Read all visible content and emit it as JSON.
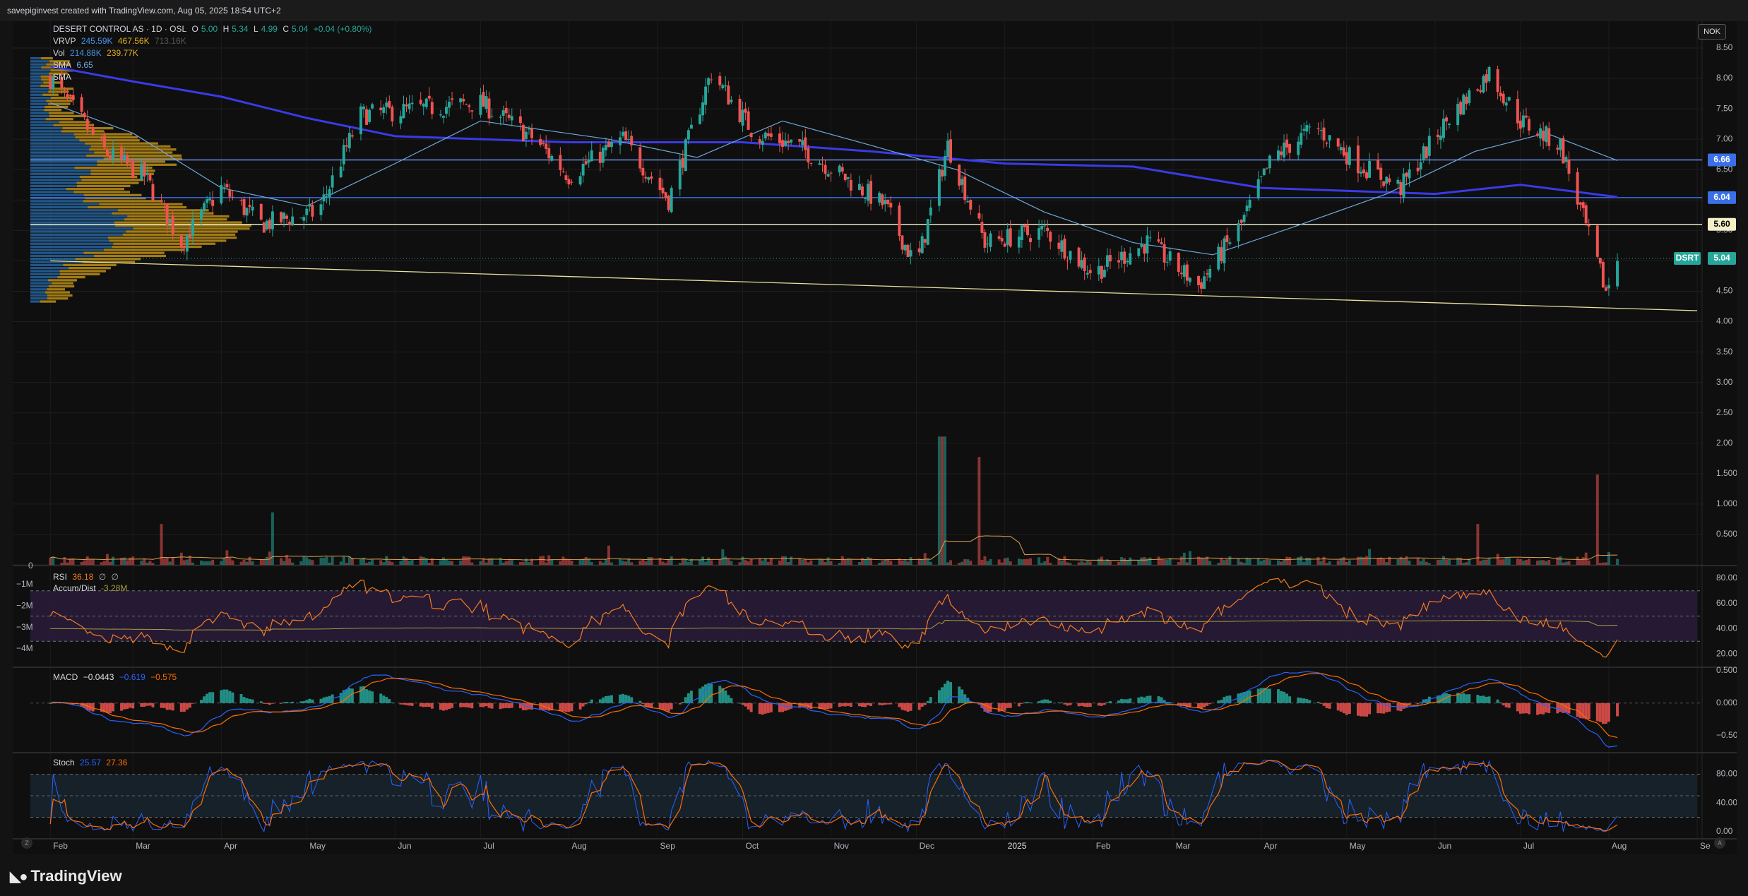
{
  "header": {
    "caption": "savepiginvest created with TradingView.com, Aug 05, 2025 18:54 UTC+2"
  },
  "currency_button": "NOK",
  "legend": {
    "title": "DESERT CONTROL AS · 1D · OSL",
    "ohlc": {
      "o_label": "O",
      "o": "5.00",
      "h_label": "H",
      "h": "5.34",
      "l_label": "L",
      "l": "4.99",
      "c_label": "C",
      "c": "5.04",
      "change": "+0.04 (+0.80%)"
    },
    "vrvp": {
      "label": "VRVP",
      "v1": "245.59K",
      "v2": "467.56K",
      "v3": "713.16K"
    },
    "vol": {
      "label": "Vol",
      "v1": "214.88K",
      "v2": "239.77K"
    },
    "sma1": {
      "label": "SMA",
      "value": "6.65"
    },
    "sma2": {
      "label": "SMA"
    },
    "rsi": {
      "label": "RSI",
      "value": "36.18",
      "extra1": "∅",
      "extra2": "∅"
    },
    "accum": {
      "label": "Accum/Dist",
      "value": "-3.28M"
    },
    "macd": {
      "label": "MACD",
      "v1": "−0.0443",
      "v2": "−0.619",
      "v3": "−0.575"
    },
    "stoch": {
      "label": "Stoch",
      "v1": "25.57",
      "v2": "27.36"
    }
  },
  "colors": {
    "up": "#26a69a",
    "down": "#ef5350",
    "sma_long": "#3a3ae8",
    "sma_short": "#6fa8dc",
    "vrvp_up": "#2a6fb0",
    "vrvp_down": "#d4a017",
    "trend": "#e8e1a0",
    "rsi": "#f57c1f",
    "accum": "#a89b3c",
    "macd": "#2962ff",
    "signal": "#ff6d00",
    "stoch_k": "#2962ff",
    "stoch_d": "#ff6d00",
    "hline_white": "#e0e0c0",
    "hline_blue": "#3a6fe8"
  },
  "price_axis_labels": [
    "8.50",
    "8.00",
    "7.50",
    "7.00",
    "6.50",
    "6.00",
    "5.50",
    "5.00",
    "4.50",
    "4.00",
    "3.50",
    "3.00",
    "2.50",
    "2.00",
    "1.500",
    "1.000",
    "0.500",
    "0"
  ],
  "price_axis_values": [
    8.5,
    8.0,
    7.5,
    7.0,
    6.5,
    6.0,
    5.5,
    5.0,
    4.5,
    4.0,
    3.5,
    3.0,
    2.5,
    2.0,
    1.5,
    1.0,
    0.5,
    0
  ],
  "price_tags": [
    {
      "text": "6.66",
      "value": 6.66,
      "bg": "#3a6fe8",
      "fg": "#ffffff"
    },
    {
      "text": "6.04",
      "value": 6.04,
      "bg": "#3a6fe8",
      "fg": "#ffffff"
    },
    {
      "text": "5.60",
      "value": 5.6,
      "bg": "#f3f0c8",
      "fg": "#000000"
    },
    {
      "text": "5.04",
      "value": 5.04,
      "bg": "#26a69a",
      "fg": "#ffffff"
    }
  ],
  "ticker_tag": "DSRT",
  "rsi_axis_labels": [
    "80.00",
    "60.00",
    "40.00",
    "20.00"
  ],
  "rsi_axis_values": [
    80,
    60,
    40,
    20
  ],
  "accum_axis_labels": [
    "−1M",
    "−2M",
    "−3M",
    "−4M"
  ],
  "macd_axis_labels": [
    "0.500",
    "0.0000",
    "−0.500"
  ],
  "macd_axis_values": [
    0.5,
    0,
    -0.5
  ],
  "stoch_axis_labels": [
    "80.00",
    "40.00",
    "0.00"
  ],
  "stoch_axis_values": [
    80,
    40,
    0
  ],
  "x_labels": [
    "Feb",
    "Mar",
    "Apr",
    "May",
    "Jun",
    "Jul",
    "Aug",
    "Sep",
    "Oct",
    "Nov",
    "Dec",
    "2025",
    "Feb",
    "Mar",
    "Apr",
    "May",
    "Jun",
    "Jul",
    "Aug",
    "Se"
  ],
  "logo_text": "TradingView",
  "corner_left": "Z",
  "corner_right": "A",
  "chart_data": {
    "type": "candlestick",
    "title": "DESERT CONTROL AS · 1D · OSL",
    "x_range": [
      "2024-01-25",
      "2025-09-01"
    ],
    "ylim": [
      0,
      8.5
    ],
    "horizontal_lines": [
      6.66,
      6.04,
      5.6
    ],
    "trendline": {
      "from": {
        "date": "2024-02-01",
        "value": 5.0
      },
      "to": {
        "date": "2025-09-01",
        "value": 4.18
      }
    },
    "close_anchors": [
      {
        "date": "2024-02-01",
        "close": 8.0
      },
      {
        "date": "2024-02-20",
        "close": 6.8
      },
      {
        "date": "2024-03-05",
        "close": 6.4
      },
      {
        "date": "2024-03-18",
        "close": 5.3
      },
      {
        "date": "2024-04-01",
        "close": 6.2
      },
      {
        "date": "2024-04-15",
        "close": 5.6
      },
      {
        "date": "2024-05-05",
        "close": 5.8
      },
      {
        "date": "2024-05-20",
        "close": 7.4
      },
      {
        "date": "2024-06-10",
        "close": 7.5
      },
      {
        "date": "2024-07-01",
        "close": 7.6
      },
      {
        "date": "2024-07-20",
        "close": 7.0
      },
      {
        "date": "2024-08-01",
        "close": 6.4
      },
      {
        "date": "2024-08-20",
        "close": 7.0
      },
      {
        "date": "2024-09-05",
        "close": 6.0
      },
      {
        "date": "2024-09-20",
        "close": 8.1
      },
      {
        "date": "2024-10-05",
        "close": 7.1
      },
      {
        "date": "2024-10-20",
        "close": 6.9
      },
      {
        "date": "2024-11-05",
        "close": 6.4
      },
      {
        "date": "2024-11-20",
        "close": 5.9
      },
      {
        "date": "2024-12-01",
        "close": 4.9
      },
      {
        "date": "2024-12-12",
        "close": 6.9
      },
      {
        "date": "2024-12-25",
        "close": 5.3
      },
      {
        "date": "2025-01-15",
        "close": 5.5
      },
      {
        "date": "2025-02-01",
        "close": 4.8
      },
      {
        "date": "2025-02-20",
        "close": 5.3
      },
      {
        "date": "2025-03-10",
        "close": 4.6
      },
      {
        "date": "2025-03-25",
        "close": 5.6
      },
      {
        "date": "2025-04-05",
        "close": 6.7
      },
      {
        "date": "2025-04-20",
        "close": 7.2
      },
      {
        "date": "2025-05-05",
        "close": 6.6
      },
      {
        "date": "2025-05-20",
        "close": 6.2
      },
      {
        "date": "2025-06-05",
        "close": 7.3
      },
      {
        "date": "2025-06-20",
        "close": 8.1
      },
      {
        "date": "2025-07-01",
        "close": 7.3
      },
      {
        "date": "2025-07-15",
        "close": 6.9
      },
      {
        "date": "2025-07-25",
        "close": 5.4
      },
      {
        "date": "2025-07-31",
        "close": 4.5
      },
      {
        "date": "2025-08-04",
        "close": 5.04
      }
    ],
    "sma_long": [
      {
        "date": "2024-02-01",
        "value": 8.2
      },
      {
        "date": "2024-03-01",
        "value": 7.95
      },
      {
        "date": "2024-04-01",
        "value": 7.7
      },
      {
        "date": "2024-05-01",
        "value": 7.35
      },
      {
        "date": "2024-06-01",
        "value": 7.05
      },
      {
        "date": "2024-08-01",
        "value": 6.95
      },
      {
        "date": "2024-10-01",
        "value": 6.95
      },
      {
        "date": "2024-11-15",
        "value": 6.8
      },
      {
        "date": "2025-01-01",
        "value": 6.6
      },
      {
        "date": "2025-02-15",
        "value": 6.55
      },
      {
        "date": "2025-04-01",
        "value": 6.2
      },
      {
        "date": "2025-06-01",
        "value": 6.1
      },
      {
        "date": "2025-07-01",
        "value": 6.25
      },
      {
        "date": "2025-08-04",
        "value": 6.05
      }
    ],
    "sma_short": [
      {
        "date": "2024-02-01",
        "value": 7.6
      },
      {
        "date": "2024-03-01",
        "value": 7.1
      },
      {
        "date": "2024-04-01",
        "value": 6.2
      },
      {
        "date": "2024-05-01",
        "value": 5.9
      },
      {
        "date": "2024-06-01",
        "value": 6.6
      },
      {
        "date": "2024-07-01",
        "value": 7.3
      },
      {
        "date": "2024-08-15",
        "value": 7.0
      },
      {
        "date": "2024-09-15",
        "value": 6.7
      },
      {
        "date": "2024-10-15",
        "value": 7.3
      },
      {
        "date": "2024-11-15",
        "value": 6.9
      },
      {
        "date": "2024-12-15",
        "value": 6.5
      },
      {
        "date": "2025-01-15",
        "value": 5.8
      },
      {
        "date": "2025-02-15",
        "value": 5.3
      },
      {
        "date": "2025-03-15",
        "value": 5.1
      },
      {
        "date": "2025-04-15",
        "value": 5.6
      },
      {
        "date": "2025-05-15",
        "value": 6.1
      },
      {
        "date": "2025-06-15",
        "value": 6.8
      },
      {
        "date": "2025-07-10",
        "value": 7.1
      },
      {
        "date": "2025-08-04",
        "value": 6.65
      }
    ],
    "volume_spikes_millions": [
      {
        "date": "2024-03-10",
        "value": 0.7
      },
      {
        "date": "2024-04-20",
        "value": 0.9
      },
      {
        "date": "2024-12-10",
        "value": 2.2
      },
      {
        "date": "2024-12-22",
        "value": 1.85
      },
      {
        "date": "2025-07-27",
        "value": 1.55
      },
      {
        "date": "2025-06-15",
        "value": 0.7
      }
    ],
    "volume_ylim": [
      0,
      2.3
    ],
    "rsi_range": [
      20,
      80
    ],
    "rsi_band": [
      30,
      70
    ],
    "macd_range": [
      -0.75,
      0.55
    ],
    "stoch_range": [
      0,
      100
    ],
    "stoch_band": [
      20,
      80
    ]
  }
}
